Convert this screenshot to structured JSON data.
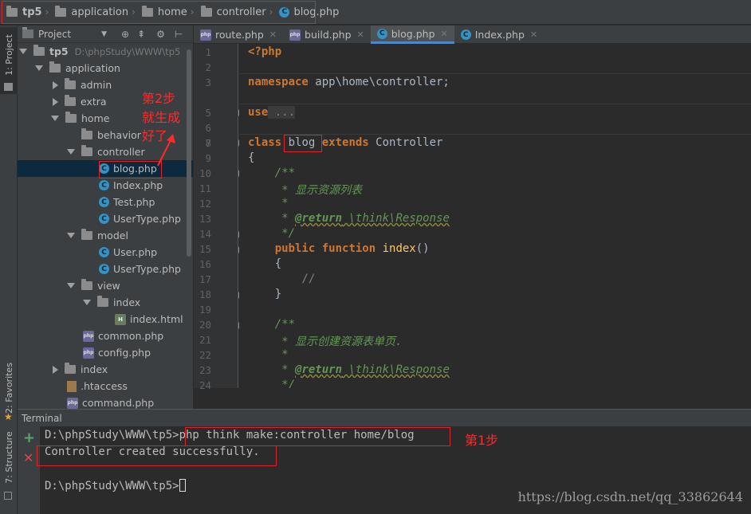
{
  "breadcrumb": [
    "tp5",
    "application",
    "home",
    "controller",
    "blog.php"
  ],
  "left_strip": {
    "project_tab": "1: Project",
    "favorites_tab": "2: Favorites",
    "structure_tab": "7: Structure"
  },
  "project_panel": {
    "title": "Project",
    "tree": [
      {
        "label": "tp5",
        "path": "D:\\phpStudy\\WWW\\tp5"
      },
      {
        "label": "application"
      },
      {
        "label": "admin"
      },
      {
        "label": "extra"
      },
      {
        "label": "home"
      },
      {
        "label": "behavior"
      },
      {
        "label": "controller"
      },
      {
        "label": "blog.php"
      },
      {
        "label": "Index.php"
      },
      {
        "label": "Test.php"
      },
      {
        "label": "UserType.php"
      },
      {
        "label": "model"
      },
      {
        "label": "User.php"
      },
      {
        "label": "UserType.php"
      },
      {
        "label": "view"
      },
      {
        "label": "index"
      },
      {
        "label": "index.html"
      },
      {
        "label": "common.php"
      },
      {
        "label": "config.php"
      },
      {
        "label": "index"
      },
      {
        "label": ".htaccess"
      },
      {
        "label": "command.php"
      }
    ]
  },
  "editor_tabs": [
    "route.php",
    "build.php",
    "blog.php",
    "Index.php"
  ],
  "line_numbers": [
    "1",
    "2",
    "3",
    "5",
    "6",
    "7",
    "8",
    "9",
    "10",
    "11",
    "12",
    "13",
    "14",
    "15",
    "16",
    "17",
    "18",
    "19",
    "20",
    "21",
    "22",
    "23",
    "24"
  ],
  "code": {
    "l1": "<?php",
    "l3_kw": "namespace",
    "l3_rest": " app\\home\\controller;",
    "l5_kw": "use",
    "l5_fold": " ...",
    "l8_kw1": "class",
    "l8_name": " blog ",
    "l8_kw2": "extends",
    "l8_rest": " Controller",
    "l9": "{",
    "l10": "    /**",
    "l11": "     * 显示资源列表",
    "l12": "     *",
    "l13_pre": "     * ",
    "l13_tag": "@return",
    "l13_type": " \\think\\Response",
    "l14": "     */",
    "l15_kw1": "    public",
    "l15_kw2": " function",
    "l15_fn": " index",
    "l15_rest": "()",
    "l16": "    {",
    "l17": "        //",
    "l18": "    }",
    "l20": "    /**",
    "l21": "     * 显示创建资源表单页.",
    "l22": "     *",
    "l23_pre": "     * ",
    "l23_tag": "@return",
    "l23_type": " \\think\\Response",
    "l24": "     */"
  },
  "annotation_step2": [
    "第2步",
    "就生成",
    "好了"
  ],
  "terminal": {
    "title": "Terminal",
    "line1_prompt": "D:\\phpStudy\\WWW\\tp5>",
    "line1_cmd": "php think make:controller home/blog",
    "line2": "Controller created successfully.",
    "line3_prompt": "D:\\phpStudy\\WWW\\tp5>",
    "step1": "第1步"
  },
  "watermark": "https://blog.csdn.net/qq_33862644",
  "colors": {
    "annotation": "#e0222a",
    "selection": "#0d293e",
    "active_tab_border": "#4a88c7"
  }
}
